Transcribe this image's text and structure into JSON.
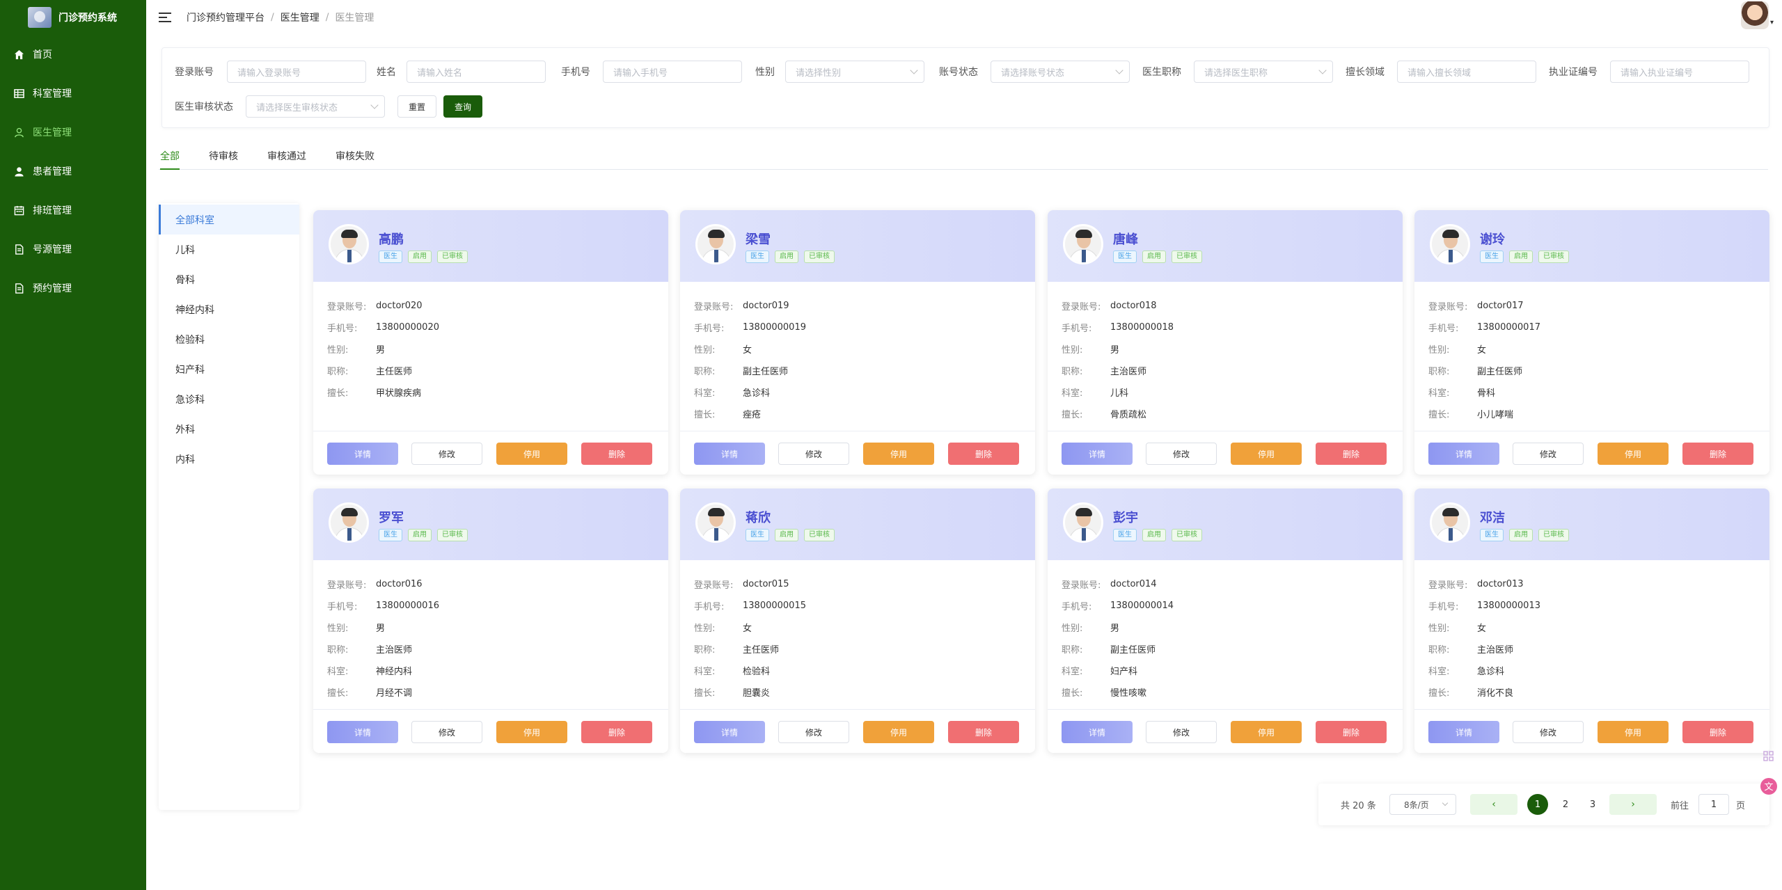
{
  "app": {
    "title": "门诊预约系统"
  },
  "sidebar": {
    "items": [
      {
        "label": "首页",
        "icon": "home-icon"
      },
      {
        "label": "科室管理",
        "icon": "grid-icon"
      },
      {
        "label": "医生管理",
        "icon": "user-icon",
        "active": true
      },
      {
        "label": "患者管理",
        "icon": "user-fill-icon"
      },
      {
        "label": "排班管理",
        "icon": "calendar-icon"
      },
      {
        "label": "号源管理",
        "icon": "document-icon"
      },
      {
        "label": "预约管理",
        "icon": "document-icon"
      }
    ]
  },
  "header": {
    "breadcrumb": [
      "门诊预约管理平台",
      "医生管理",
      "医生管理"
    ]
  },
  "search": {
    "fields": [
      {
        "label": "登录账号",
        "placeholder": "请输入登录账号"
      },
      {
        "label": "姓名",
        "placeholder": "请输入姓名"
      },
      {
        "label": "手机号",
        "placeholder": "请输入手机号"
      },
      {
        "label": "性别",
        "placeholder": "请选择性别"
      },
      {
        "label": "账号状态",
        "placeholder": "请选择账号状态"
      },
      {
        "label": "医生职称",
        "placeholder": "请选择医生职称"
      },
      {
        "label": "擅长领域",
        "placeholder": "请输入擅长领域"
      },
      {
        "label": "执业证编号",
        "placeholder": "请输入执业证编号"
      },
      {
        "label": "医生审核状态",
        "placeholder": "请选择医生审核状态"
      }
    ],
    "reset_label": "重置",
    "query_label": "查询"
  },
  "tabs": [
    "全部",
    "待审核",
    "审核通过",
    "审核失败"
  ],
  "departments": [
    "全部科室",
    "儿科",
    "骨科",
    "神经内科",
    "检验科",
    "妇产科",
    "急诊科",
    "外科",
    "内科"
  ],
  "card_labels": {
    "account": "登录账号:",
    "phone": "手机号:",
    "gender": "性别:",
    "title": "职称:",
    "dept": "科室:",
    "specialty": "擅长:"
  },
  "card_buttons": {
    "detail": "详情",
    "edit": "修改",
    "stop": "停用",
    "delete": "删除"
  },
  "doctors": [
    {
      "name": "高鹏",
      "tags": [
        "医生",
        "启用",
        "已审核"
      ],
      "account": "doctor020",
      "phone": "13800000020",
      "gender": "男",
      "title": "主任医师",
      "specialty": "甲状腺疾病"
    },
    {
      "name": "梁雪",
      "tags": [
        "医生",
        "启用",
        "已审核"
      ],
      "account": "doctor019",
      "phone": "13800000019",
      "gender": "女",
      "title": "副主任医师",
      "dept": "急诊科",
      "specialty": "痤疮"
    },
    {
      "name": "唐峰",
      "tags": [
        "医生",
        "启用",
        "已审核"
      ],
      "account": "doctor018",
      "phone": "13800000018",
      "gender": "男",
      "title": "主治医师",
      "dept": "儿科",
      "specialty": "骨质疏松"
    },
    {
      "name": "谢玲",
      "tags": [
        "医生",
        "启用",
        "已审核"
      ],
      "account": "doctor017",
      "phone": "13800000017",
      "gender": "女",
      "title": "副主任医师",
      "dept": "骨科",
      "specialty": "小儿哮喘"
    },
    {
      "name": "罗军",
      "tags": [
        "医生",
        "启用",
        "已审核"
      ],
      "account": "doctor016",
      "phone": "13800000016",
      "gender": "男",
      "title": "主治医师",
      "dept": "神经内科",
      "specialty": "月经不调"
    },
    {
      "name": "蒋欣",
      "tags": [
        "医生",
        "启用",
        "已审核"
      ],
      "account": "doctor015",
      "phone": "13800000015",
      "gender": "女",
      "title": "主任医师",
      "dept": "检验科",
      "specialty": "胆囊炎"
    },
    {
      "name": "彭宇",
      "tags": [
        "医生",
        "启用",
        "已审核"
      ],
      "account": "doctor014",
      "phone": "13800000014",
      "gender": "男",
      "title": "副主任医师",
      "dept": "妇产科",
      "specialty": "慢性咳嗽"
    },
    {
      "name": "邓洁",
      "tags": [
        "医生",
        "启用",
        "已审核"
      ],
      "account": "doctor013",
      "phone": "13800000013",
      "gender": "女",
      "title": "主治医师",
      "dept": "急诊科",
      "specialty": "消化不良"
    }
  ],
  "pagination": {
    "total": "共 20 条",
    "page_size": "8条/页",
    "pages": [
      "1",
      "2",
      "3"
    ],
    "current": "1",
    "goto_label": "前往",
    "goto_value": "1",
    "page_suffix": "页"
  }
}
